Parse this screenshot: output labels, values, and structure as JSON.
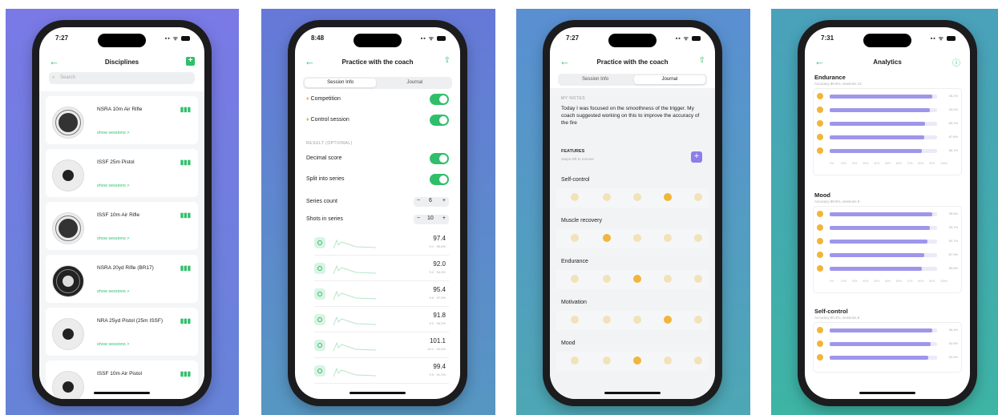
{
  "colors": {
    "accent": "#2fbf6a",
    "purple": "#9e96ea"
  },
  "phone1": {
    "time": "7:27",
    "title": "Disciplines",
    "search_placeholder": "Search",
    "show_sessions": "show sessions >",
    "items": [
      {
        "name": "NSRA 10m Air Rifle",
        "target": "rifle"
      },
      {
        "name": "ISSF 25m Pistol",
        "target": "pistol"
      },
      {
        "name": "ISSF 10m Air Rifle",
        "target": "rifle"
      },
      {
        "name": "NSRA 20yd Rifle (BR17)",
        "target": "br17"
      },
      {
        "name": "NRA 25yd Pistol (25m ISSF)",
        "target": "pistol"
      },
      {
        "name": "ISSF 10m Air Pistol",
        "target": "pistol"
      }
    ]
  },
  "phone2": {
    "time": "8:48",
    "title": "Practice with the coach",
    "tabs": [
      "Session Info",
      "Journal"
    ],
    "competition": "Competition",
    "control_session": "Control session",
    "result_header": "RESULT (OPTIONAL)",
    "decimal_score": "Decimal score",
    "split_series": "Split into series",
    "series_count_label": "Series count",
    "series_count": "6",
    "shots_label": "Shots in series",
    "shots": "10",
    "series": [
      {
        "score": "97.4",
        "sub": "9.1 · 95.6%"
      },
      {
        "score": "92.0",
        "sub": "9.2 · 94.6%"
      },
      {
        "score": "95.4",
        "sub": "9.5 · 97.9%"
      },
      {
        "score": "91.8",
        "sub": "9.2 · 94.2%"
      },
      {
        "score": "101.1",
        "sub": "10.1 · 93.6%"
      },
      {
        "score": "99.4",
        "sub": "9.9 · 91.2%"
      }
    ]
  },
  "phone3": {
    "time": "7:27",
    "title": "Practice with the coach",
    "tabs": [
      "Session Info",
      "Journal"
    ],
    "notes_header": "MY NOTES",
    "notes": "Today I was focused on the smoothness of the trigger. My coach suggested working on this to improve the accuracy of the fire",
    "features_header": "FEATURES",
    "features_sub": "Swipe left to remove",
    "features": [
      {
        "name": "Self-control",
        "selected": 3
      },
      {
        "name": "Muscle recovery",
        "selected": 1
      },
      {
        "name": "Endurance",
        "selected": 2
      },
      {
        "name": "Motivation",
        "selected": 3
      },
      {
        "name": "Mood",
        "selected": 2
      }
    ]
  },
  "phone4": {
    "time": "7:31",
    "title": "Analytics",
    "axis": [
      "0%",
      "10%",
      "20%",
      "30%",
      "40%",
      "50%",
      "60%",
      "70%",
      "80%",
      "90%",
      "100%"
    ],
    "sections": [
      {
        "name": "Endurance",
        "sub": "Accuracy 89.6%, sessions 12",
        "bars": [
          {
            "value": 95.2,
            "label": "95.2%"
          },
          {
            "value": 93.2,
            "label": "93.2%"
          },
          {
            "value": 89.1,
            "label": "89.1%"
          },
          {
            "value": 87.8,
            "label": "87.8%"
          },
          {
            "value": 86.1,
            "label": "86.1%"
          }
        ]
      },
      {
        "name": "Mood",
        "sub": "Accuracy 89.5%, sessions 9",
        "bars": [
          {
            "value": 95.6,
            "label": "95.6%"
          },
          {
            "value": 93.1,
            "label": "93.1%"
          },
          {
            "value": 90.7,
            "label": "90.7%"
          },
          {
            "value": 87.9,
            "label": "87.9%"
          },
          {
            "value": 85.8,
            "label": "85.8%"
          }
        ]
      },
      {
        "name": "Self-control",
        "sub": "Accuracy 90.3%, sessions 8",
        "bars": [
          {
            "value": 95.4,
            "label": "95.4%"
          },
          {
            "value": 93.9,
            "label": "93.9%"
          },
          {
            "value": 92.0,
            "label": "92.0%"
          }
        ]
      }
    ]
  }
}
